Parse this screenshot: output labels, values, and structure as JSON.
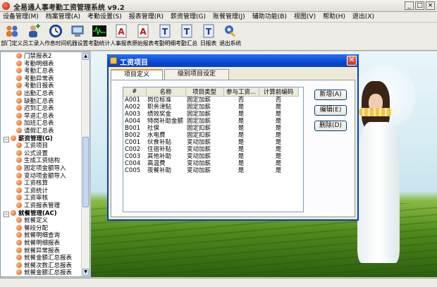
{
  "window": {
    "title": "全易通人事考勤工资管理系统  v9.2",
    "controls": [
      "_",
      "□",
      "×"
    ]
  },
  "menu": [
    "设备管理(M)",
    "档案管理(A)",
    "考勤设置(S)",
    "报表管理(R)",
    "薪资管理(G)",
    "账餐管理(J)",
    "辅助功能(B)",
    "视图(V)",
    "帮助(H)",
    "退出(X)"
  ],
  "toolbar": [
    {
      "label": "部门定义",
      "icon": "people-group-icon"
    },
    {
      "label": "员工录入",
      "icon": "person-add-icon"
    },
    {
      "label": "作息时间",
      "icon": "clock-icon"
    },
    {
      "label": "机器设置",
      "icon": "computer-icon"
    },
    {
      "label": "考勤统计",
      "icon": "waveform-icon"
    },
    {
      "label": "人事报表",
      "icon": "report-a-icon"
    },
    {
      "label": "原始报表",
      "icon": "report-a2-icon"
    },
    {
      "label": "考勤明细",
      "icon": "report-t-icon"
    },
    {
      "label": "考勤汇总",
      "icon": "report-t2-icon"
    },
    {
      "label": "日报表",
      "icon": "report-t3-icon"
    },
    {
      "label": "退出系统",
      "icon": "exit-key-icon"
    }
  ],
  "tree": [
    {
      "text": "门禁报表2",
      "level": 2,
      "kind": "leaf"
    },
    {
      "text": "考勤明细表",
      "level": 2,
      "kind": "leaf"
    },
    {
      "text": "考勤汇总表",
      "level": 2,
      "kind": "leaf"
    },
    {
      "text": "考勤异常表",
      "level": 2,
      "kind": "leaf"
    },
    {
      "text": "考勤日报表",
      "level": 2,
      "kind": "leaf"
    },
    {
      "text": "出勤汇总表",
      "level": 2,
      "kind": "leaf"
    },
    {
      "text": "缺勤汇总表",
      "level": 2,
      "kind": "leaf"
    },
    {
      "text": "迟到汇总表",
      "level": 2,
      "kind": "leaf"
    },
    {
      "text": "早退汇总表",
      "level": 2,
      "kind": "leaf"
    },
    {
      "text": "加班汇总表",
      "level": 2,
      "kind": "leaf"
    },
    {
      "text": "请假汇总表",
      "level": 2,
      "kind": "leaf"
    },
    {
      "text": "薪资管理(G)",
      "level": 1,
      "kind": "group",
      "expander": "−"
    },
    {
      "text": "工资项目",
      "level": 2,
      "kind": "leaf"
    },
    {
      "text": "公式设置",
      "level": 2,
      "kind": "leaf"
    },
    {
      "text": "生成工资结构",
      "level": 2,
      "kind": "leaf"
    },
    {
      "text": "固定项金额导入",
      "level": 2,
      "kind": "leaf"
    },
    {
      "text": "变动项金额导入",
      "level": 2,
      "kind": "leaf"
    },
    {
      "text": "工资核算",
      "level": 2,
      "kind": "leaf"
    },
    {
      "text": "工资统计",
      "level": 2,
      "kind": "leaf"
    },
    {
      "text": "工资审核",
      "level": 2,
      "kind": "leaf"
    },
    {
      "text": "工资报表管理",
      "level": 2,
      "kind": "leaf"
    },
    {
      "text": "就餐管理(AC)",
      "level": 1,
      "kind": "group",
      "expander": "−"
    },
    {
      "text": "就餐定义",
      "level": 2,
      "kind": "leaf"
    },
    {
      "text": "餐段分配",
      "level": 2,
      "kind": "leaf"
    },
    {
      "text": "就餐明细查询",
      "level": 2,
      "kind": "leaf"
    },
    {
      "text": "就餐明细报表",
      "level": 2,
      "kind": "leaf"
    },
    {
      "text": "就餐异常报表",
      "level": 2,
      "kind": "leaf"
    },
    {
      "text": "就餐金额汇总报表",
      "level": 2,
      "kind": "leaf"
    },
    {
      "text": "就餐次数汇总报表",
      "level": 2,
      "kind": "leaf"
    },
    {
      "text": "就餐金额汇总报表",
      "level": 2,
      "kind": "leaf"
    }
  ],
  "dialog": {
    "title": "工资项目",
    "tabs": [
      "项目定义",
      "级别项目设定"
    ],
    "active_tab": 0,
    "columns": [
      "#",
      "名称",
      "项目类型",
      "参与工资...",
      "计算前编码"
    ],
    "rows": [
      [
        "A001",
        "岗位标准",
        "固定加薪",
        "否",
        "否"
      ],
      [
        "A002",
        "职务津贴",
        "固定加薪",
        "是",
        "是"
      ],
      [
        "A003",
        "绩效奖金",
        "固定加薪",
        "是",
        "是"
      ],
      [
        "A004",
        "特岗补助金额",
        "固定加薪",
        "是",
        "是"
      ],
      [
        "B001",
        "社保",
        "固定扣薪",
        "是",
        "是"
      ],
      [
        "B002",
        "水电费",
        "固定扣薪",
        "是",
        "是"
      ],
      [
        "C001",
        "伙食补贴",
        "变动加薪",
        "是",
        "是"
      ],
      [
        "C002",
        "住宿补贴",
        "变动加薪",
        "是",
        "是"
      ],
      [
        "C003",
        "其他补助",
        "变动加薪",
        "是",
        "是"
      ],
      [
        "C004",
        "高温费",
        "变动加薪",
        "是",
        "是"
      ],
      [
        "C005",
        "夜餐补助",
        "变动加薪",
        "是",
        "是"
      ]
    ],
    "buttons": {
      "add": "新增(A)",
      "edit": "编辑(E)",
      "delete": "删除(D)"
    }
  },
  "colors": {
    "dialog_title": "#0a4ad6",
    "tab_highlight": "#e69a26",
    "tree_bullet": "#e0561a"
  }
}
